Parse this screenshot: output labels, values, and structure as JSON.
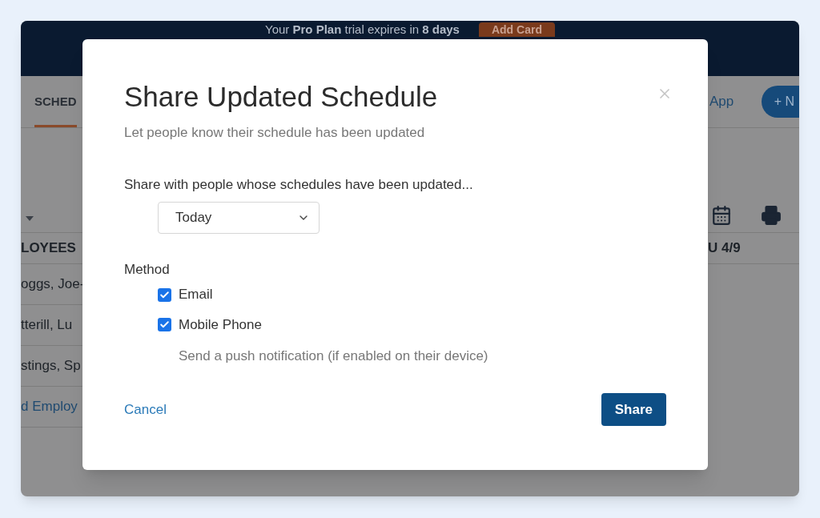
{
  "banner": {
    "text": "Your **Pro Plan** trial expires in **8 days**",
    "button": "Add Card"
  },
  "background": {
    "tab": "SCHED",
    "link": "App",
    "new_button": "+ N",
    "left_header": "LOYEES",
    "rows": [
      "oggs, Joe-",
      "tterill, Lu",
      "stings, Sp"
    ],
    "add_link": "d Employ",
    "right_header": "U 4/9"
  },
  "dialog": {
    "title": "Share Updated Schedule",
    "subtitle": "Let people know their schedule has been updated",
    "share_label": "Share with people whose schedules have been updated...",
    "period": {
      "value": "Today"
    },
    "method_label": "Method",
    "methods": [
      {
        "label": "Email",
        "checked": true
      },
      {
        "label": "Mobile Phone",
        "checked": true,
        "hint": "Send a push notification (if enabled on their device)"
      }
    ],
    "cancel": "Cancel",
    "submit": "Share"
  }
}
